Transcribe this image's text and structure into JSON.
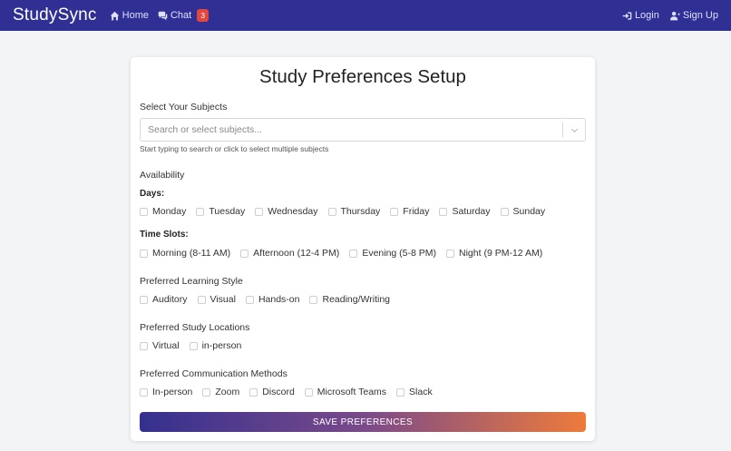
{
  "nav": {
    "brand": "StudySync",
    "home_label": "Home",
    "chat_label": "Chat",
    "chat_badge": "3",
    "login_label": "Login",
    "signup_label": "Sign Up"
  },
  "form": {
    "title": "Study Preferences Setup",
    "subjects": {
      "label": "Select Your Subjects",
      "placeholder": "Search or select subjects...",
      "helper": "Start typing to search or click to select multiple subjects"
    },
    "availability": {
      "label": "Availability",
      "days_label": "Days:",
      "days": [
        "Monday",
        "Tuesday",
        "Wednesday",
        "Thursday",
        "Friday",
        "Saturday",
        "Sunday"
      ],
      "slots_label": "Time Slots:",
      "slots": [
        "Morning (8-11 AM)",
        "Afternoon (12-4 PM)",
        "Evening (5-8 PM)",
        "Night (9 PM-12 AM)"
      ]
    },
    "learning_style": {
      "label": "Preferred Learning Style",
      "options": [
        "Auditory",
        "Visual",
        "Hands-on",
        "Reading/Writing"
      ]
    },
    "locations": {
      "label": "Preferred Study Locations",
      "options": [
        "Virtual",
        "in-person"
      ]
    },
    "communication": {
      "label": "Preferred Communication Methods",
      "options": [
        "In-person",
        "Zoom",
        "Discord",
        "Microsoft Teams",
        "Slack"
      ]
    },
    "save_label": "SAVE PREFERENCES"
  },
  "colors": {
    "navbar": "#2f2f94",
    "badge": "#e0483f",
    "button_start": "#34308f",
    "button_end": "#ee7b3a"
  }
}
